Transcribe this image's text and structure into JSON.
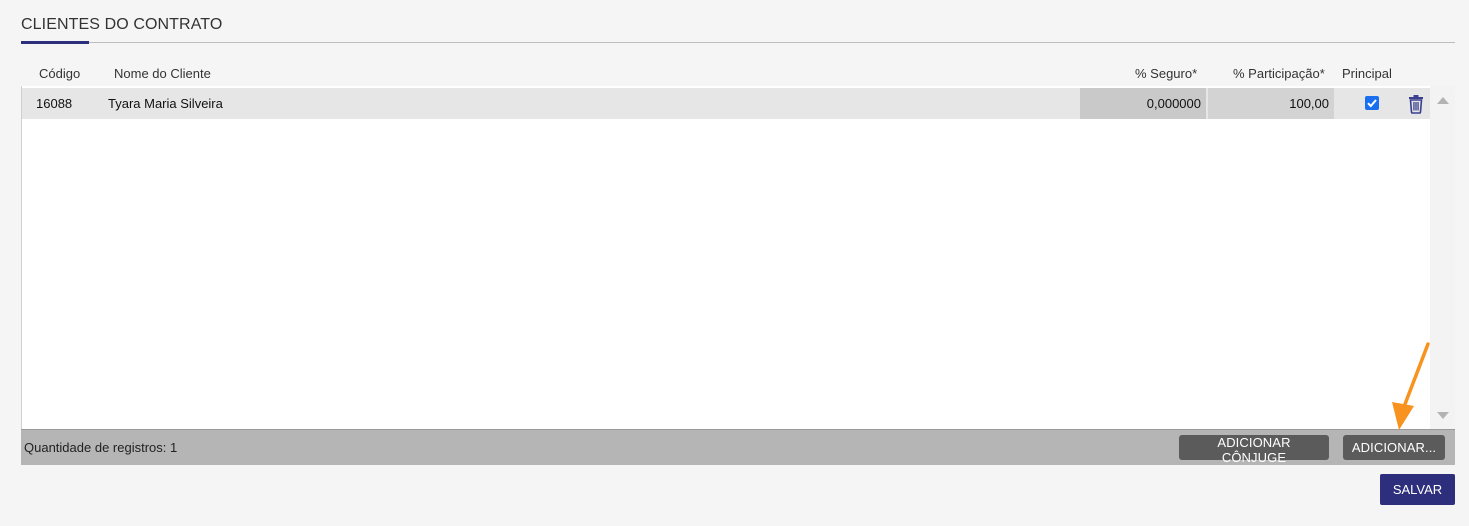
{
  "section": {
    "title": "CLIENTES DO CONTRATO"
  },
  "columns": {
    "codigo": "Código",
    "nome": "Nome do Cliente",
    "seguro": "% Seguro*",
    "participacao": "% Participação*",
    "principal": "Principal"
  },
  "rows": [
    {
      "codigo": "16088",
      "nome": "Tyara Maria Silveira",
      "seguro": "0,000000",
      "participacao": "100,00",
      "principal": true
    }
  ],
  "footer": {
    "count_label": "Quantidade de registros: 1",
    "btn_conjuge": "ADICIONAR CÔNJUGE",
    "btn_adicionar": "ADICIONAR..."
  },
  "actions": {
    "salvar": "SALVAR"
  },
  "colors": {
    "accent": "#2d2f7d",
    "checkbox": "#1a6ff0",
    "arrow": "#f7931e"
  }
}
